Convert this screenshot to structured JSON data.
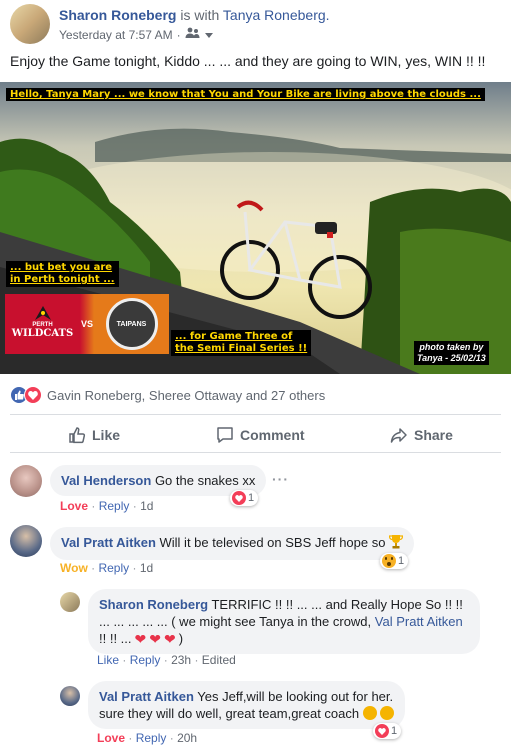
{
  "post": {
    "author": "Sharon Roneberg",
    "with_text": "is with",
    "tagged": "Tanya Roneberg.",
    "time": "Yesterday at 7:57 AM",
    "text": "Enjoy the Game tonight, Kiddo ... ... and they are going to WIN, yes, WIN !! !!"
  },
  "photo": {
    "banner_top": "Hello, Tanya Mary ... we know that You and Your Bike are living above the clouds ...",
    "perth_line1": "... but bet you are",
    "perth_line2": "in Perth tonight ...",
    "game_line1": "... for Game Three of",
    "game_line2": "the Semi Final Series !!",
    "credit_line1": "photo taken by",
    "credit_line2": "Tanya - 25/02/13",
    "team_left": "WILDCATS",
    "team_left_small": "PERTH",
    "vs": "VS",
    "team_right": "TAIPANS"
  },
  "reactions": {
    "summary": "Gavin Roneberg, Sheree Ottaway and 27 others"
  },
  "action_bar": {
    "like": "Like",
    "comment": "Comment",
    "share": "Share"
  },
  "comments": [
    {
      "author": "Val Henderson",
      "text": "Go the snakes xx",
      "reaction_label": "Love",
      "reply": "Reply",
      "time": "1d",
      "count": "1"
    },
    {
      "author": "Val Pratt Aitken",
      "text": "Will it be televised on SBS Jeff hope so",
      "reaction_label": "Wow",
      "reply": "Reply",
      "time": "1d",
      "count": "1"
    }
  ],
  "replies": [
    {
      "author": "Sharon Roneberg",
      "text1": "TERRIFIC !! !! ... ... and Really Hope So !! !!",
      "text2": "... ... ... ... ... ( we might see Tanya in the crowd,",
      "mention": "Val Pratt Aitken",
      "text3": "!! !! ...",
      "text4": ")",
      "like": "Like",
      "reply": "Reply",
      "time": "23h",
      "edited": "Edited"
    },
    {
      "author": "Val Pratt Aitken",
      "text1": "Yes Jeff,will be looking out for her.",
      "text2": "sure they will do well, great team,great coach",
      "reaction_label": "Love",
      "reply": "Reply",
      "time": "20h",
      "count": "1"
    }
  ],
  "colors": {
    "link": "#365899",
    "love": "#f33e58",
    "wow": "#f7b125",
    "like_blue": "#4267b2"
  }
}
